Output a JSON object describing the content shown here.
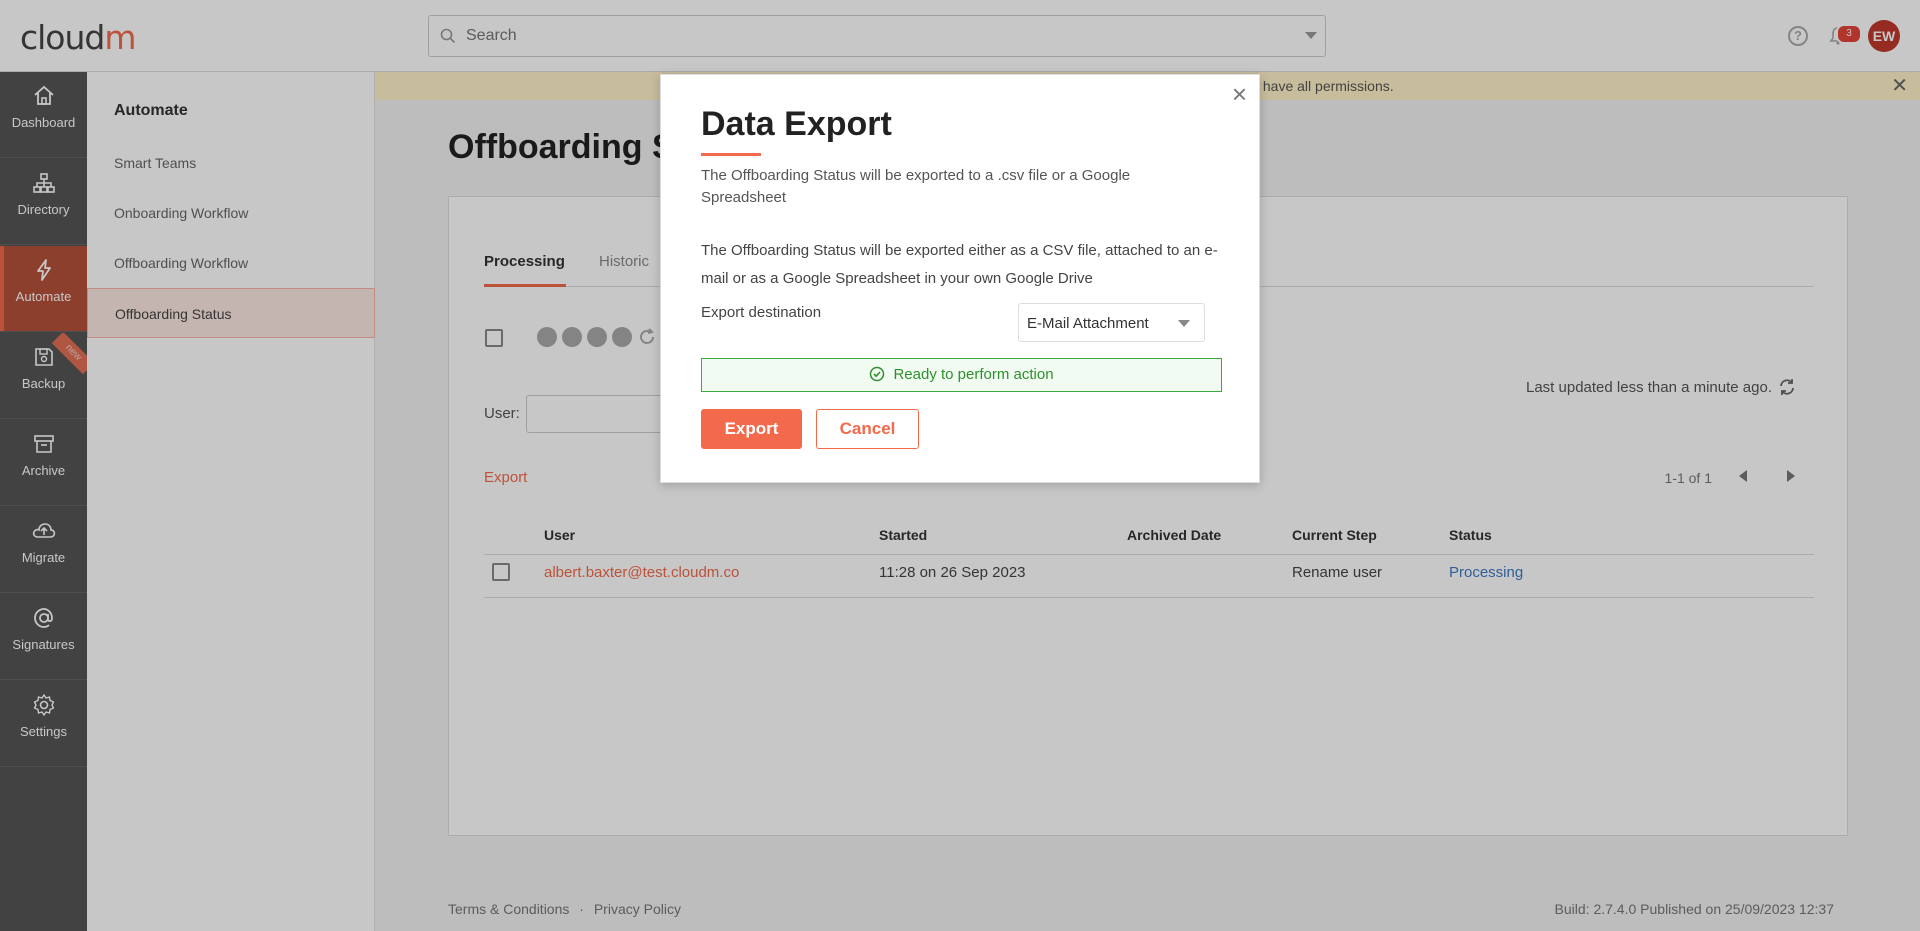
{
  "app": {
    "logo_text": "cloud",
    "logo_accent": "m",
    "brand_color": "#f26a4b"
  },
  "topbar": {
    "search_placeholder": "Search",
    "notification_count": "3",
    "avatar_initials": "EW"
  },
  "rail": {
    "items": [
      {
        "label": "Dashboard",
        "icon": "home-icon"
      },
      {
        "label": "Directory",
        "icon": "org-chart-icon"
      },
      {
        "label": "Automate",
        "icon": "lightning-icon",
        "active": true
      },
      {
        "label": "Backup",
        "icon": "save-icon",
        "badge": "new"
      },
      {
        "label": "Archive",
        "icon": "archive-box-icon"
      },
      {
        "label": "Migrate",
        "icon": "cloud-upload-icon"
      },
      {
        "label": "Signatures",
        "icon": "at-sign-icon"
      },
      {
        "label": "Settings",
        "icon": "gear-icon"
      }
    ]
  },
  "subnav": {
    "heading": "Automate",
    "items": [
      {
        "label": "Smart Teams"
      },
      {
        "label": "Onboarding Workflow"
      },
      {
        "label": "Offboarding Workflow"
      },
      {
        "label": "Offboarding Status",
        "active": true
      }
    ]
  },
  "banner": {
    "text": "ys have all permissions."
  },
  "main": {
    "title": "Offboarding S",
    "tabs": [
      {
        "label": "Processing",
        "active": true
      },
      {
        "label": "Historic"
      }
    ],
    "user_label": "User:",
    "last_updated": "Last updated less than a minute ago.",
    "export_link": "Export",
    "pager_text": "1-1 of 1",
    "table": {
      "columns": [
        "User",
        "Started",
        "Archived Date",
        "Current Step",
        "Status"
      ],
      "rows": [
        {
          "user": "albert.baxter@test.cloudm.co",
          "started": "11:28 on 26 Sep 2023",
          "archived": "",
          "step": "Rename user",
          "status": "Processing"
        }
      ]
    }
  },
  "footer": {
    "terms": "Terms & Conditions",
    "separator": "·",
    "privacy": "Privacy Policy",
    "build": "Build: 2.7.4.0 Published on 25/09/2023 12:37"
  },
  "modal": {
    "title": "Data Export",
    "subtitle": "The Offboarding Status will be exported to a .csv file or a Google Spreadsheet",
    "description": "The Offboarding Status will be exported either as a CSV file, attached to an e-mail or as a Google Spreadsheet in your own Google Drive",
    "destination_label": "Export destination",
    "destination_value": "E-Mail Attachment",
    "status_text": "Ready to perform action",
    "export_button": "Export",
    "cancel_button": "Cancel",
    "close_symbol": "×"
  }
}
